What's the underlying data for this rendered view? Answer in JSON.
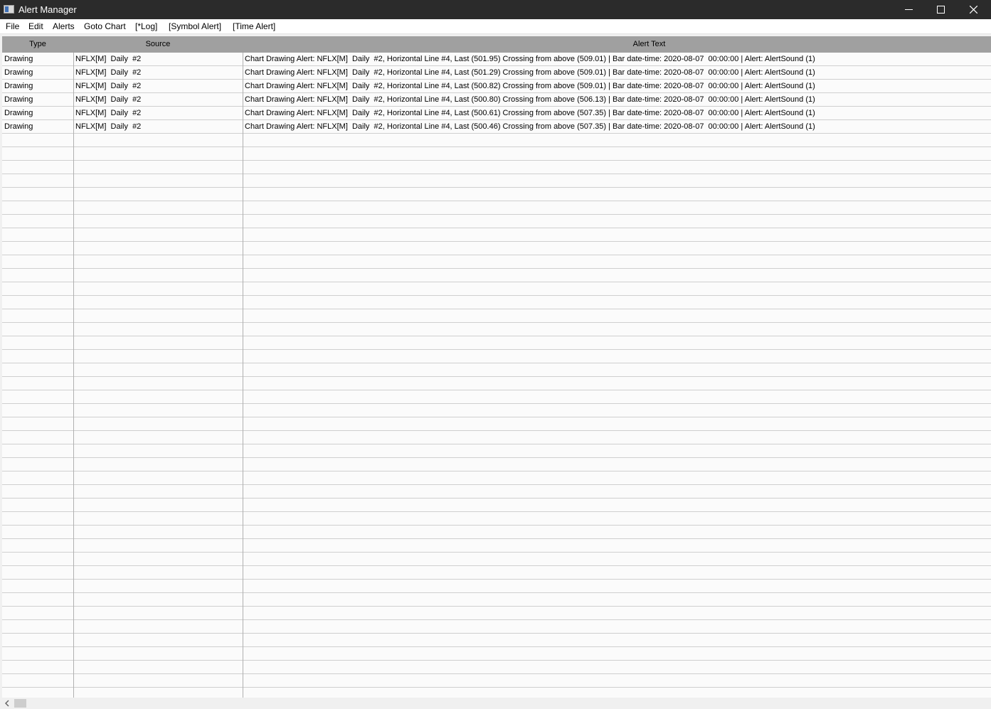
{
  "window": {
    "title": "Alert Manager"
  },
  "menu": {
    "items": [
      "File",
      "Edit",
      "Alerts",
      "Goto Chart",
      "[*Log]",
      "[Symbol Alert]",
      "[Time Alert]"
    ]
  },
  "table": {
    "columns": [
      "Type",
      "Source",
      "Alert Text"
    ],
    "rows": [
      {
        "type": "Drawing",
        "source": "NFLX[M]  Daily  #2",
        "text": "Chart Drawing Alert: NFLX[M]  Daily  #2, Horizontal Line #4, Last (501.95) Crossing from above (509.01) | Bar date-time: 2020-08-07  00:00:00 | Alert: AlertSound (1)"
      },
      {
        "type": "Drawing",
        "source": "NFLX[M]  Daily  #2",
        "text": "Chart Drawing Alert: NFLX[M]  Daily  #2, Horizontal Line #4, Last (501.29) Crossing from above (509.01) | Bar date-time: 2020-08-07  00:00:00 | Alert: AlertSound (1)"
      },
      {
        "type": "Drawing",
        "source": "NFLX[M]  Daily  #2",
        "text": "Chart Drawing Alert: NFLX[M]  Daily  #2, Horizontal Line #4, Last (500.82) Crossing from above (509.01) | Bar date-time: 2020-08-07  00:00:00 | Alert: AlertSound (1)"
      },
      {
        "type": "Drawing",
        "source": "NFLX[M]  Daily  #2",
        "text": "Chart Drawing Alert: NFLX[M]  Daily  #2, Horizontal Line #4, Last (500.80) Crossing from above (506.13) | Bar date-time: 2020-08-07  00:00:00 | Alert: AlertSound (1)"
      },
      {
        "type": "Drawing",
        "source": "NFLX[M]  Daily  #2",
        "text": "Chart Drawing Alert: NFLX[M]  Daily  #2, Horizontal Line #4, Last (500.61) Crossing from above (507.35) | Bar date-time: 2020-08-07  00:00:00 | Alert: AlertSound (1)"
      },
      {
        "type": "Drawing",
        "source": "NFLX[M]  Daily  #2",
        "text": "Chart Drawing Alert: NFLX[M]  Daily  #2, Horizontal Line #4, Last (500.46) Crossing from above (507.35) | Bar date-time: 2020-08-07  00:00:00 | Alert: AlertSound (1)"
      }
    ]
  },
  "colors": {
    "titlebar": "#2b2b2b",
    "header": "#a0a0a0",
    "grid_bg": "#fbfbfb",
    "row_line": "#cfcfcf"
  }
}
